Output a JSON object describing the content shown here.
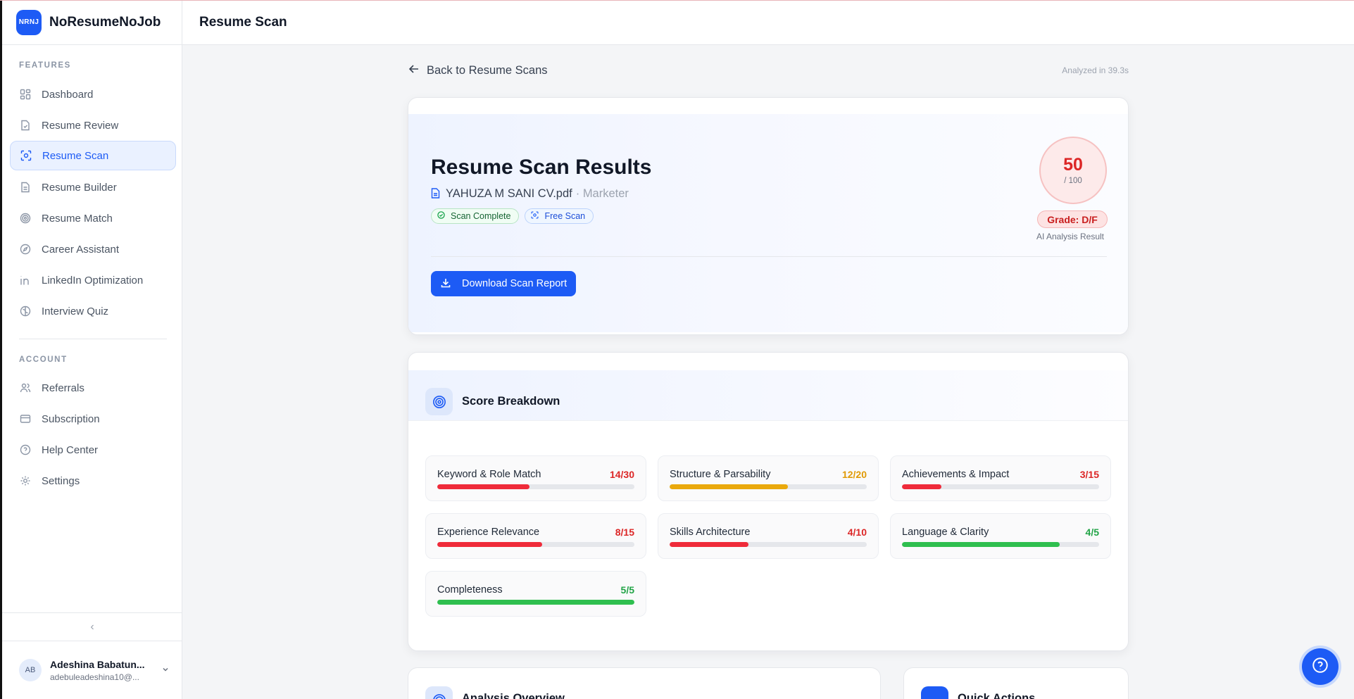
{
  "brand": {
    "logo_text": "NRNJ",
    "name": "NoResumeNoJob"
  },
  "header": {
    "title": "Resume Scan"
  },
  "sidebar": {
    "features_label": "FEATURES",
    "account_label": "ACCOUNT",
    "features": [
      {
        "label": "Dashboard",
        "icon": "grid-icon"
      },
      {
        "label": "Resume Review",
        "icon": "file-check-icon"
      },
      {
        "label": "Resume Scan",
        "icon": "scan-icon",
        "active": true
      },
      {
        "label": "Resume Builder",
        "icon": "file-text-icon"
      },
      {
        "label": "Resume Match",
        "icon": "target-icon"
      },
      {
        "label": "Career Assistant",
        "icon": "compass-icon"
      },
      {
        "label": "LinkedIn Optimization",
        "icon": "linkedin-icon"
      },
      {
        "label": "Interview Quiz",
        "icon": "brain-icon"
      }
    ],
    "account": [
      {
        "label": "Referrals",
        "icon": "users-icon"
      },
      {
        "label": "Subscription",
        "icon": "credit-card-icon"
      },
      {
        "label": "Help Center",
        "icon": "help-circle-icon"
      },
      {
        "label": "Settings",
        "icon": "gear-icon"
      }
    ],
    "user": {
      "initials": "AB",
      "name": "Adeshina Babatun...",
      "email": "adebuleadeshina10@..."
    }
  },
  "main": {
    "back_label": "Back to Resume Scans",
    "analyzed_text": "Analyzed in 39.3s",
    "results": {
      "title": "Resume Scan Results",
      "file_name": "YAHUZA M SANI CV.pdf",
      "role": "· Marketer",
      "badges": {
        "complete": "Scan Complete",
        "free": "Free Scan"
      },
      "score": "50",
      "score_max": "/ 100",
      "grade": "Grade: D/F",
      "ai_label": "AI Analysis Result",
      "download_label": "Download Scan Report"
    },
    "breakdown": {
      "title": "Score Breakdown",
      "metrics": [
        {
          "label": "Keyword & Role Match",
          "score": "14/30",
          "fraction": 0.467,
          "color": "#ef2b3a"
        },
        {
          "label": "Structure & Parsability",
          "score": "12/20",
          "fraction": 0.6,
          "color": "#eaa90c"
        },
        {
          "label": "Achievements & Impact",
          "score": "3/15",
          "fraction": 0.2,
          "color": "#ef2b3a"
        },
        {
          "label": "Experience Relevance",
          "score": "8/15",
          "fraction": 0.533,
          "color": "#ef2b3a"
        },
        {
          "label": "Skills Architecture",
          "score": "4/10",
          "fraction": 0.4,
          "color": "#ef2b3a"
        },
        {
          "label": "Language & Clarity",
          "score": "4/5",
          "fraction": 0.8,
          "color": "#2fbf4f"
        },
        {
          "label": "Completeness",
          "score": "5/5",
          "fraction": 1.0,
          "color": "#2fbf4f"
        }
      ]
    },
    "analysis_title": "Analysis Overview",
    "quick_actions_title": "Quick Actions"
  },
  "colors": {
    "accent": "#1d5bf5",
    "danger": "#dc2626",
    "warning": "#eaa90c",
    "success": "#2fbf4f"
  },
  "score_text_colors": {
    "low": "#dc2626",
    "mid": "#e09a06",
    "high": "#22a447"
  }
}
